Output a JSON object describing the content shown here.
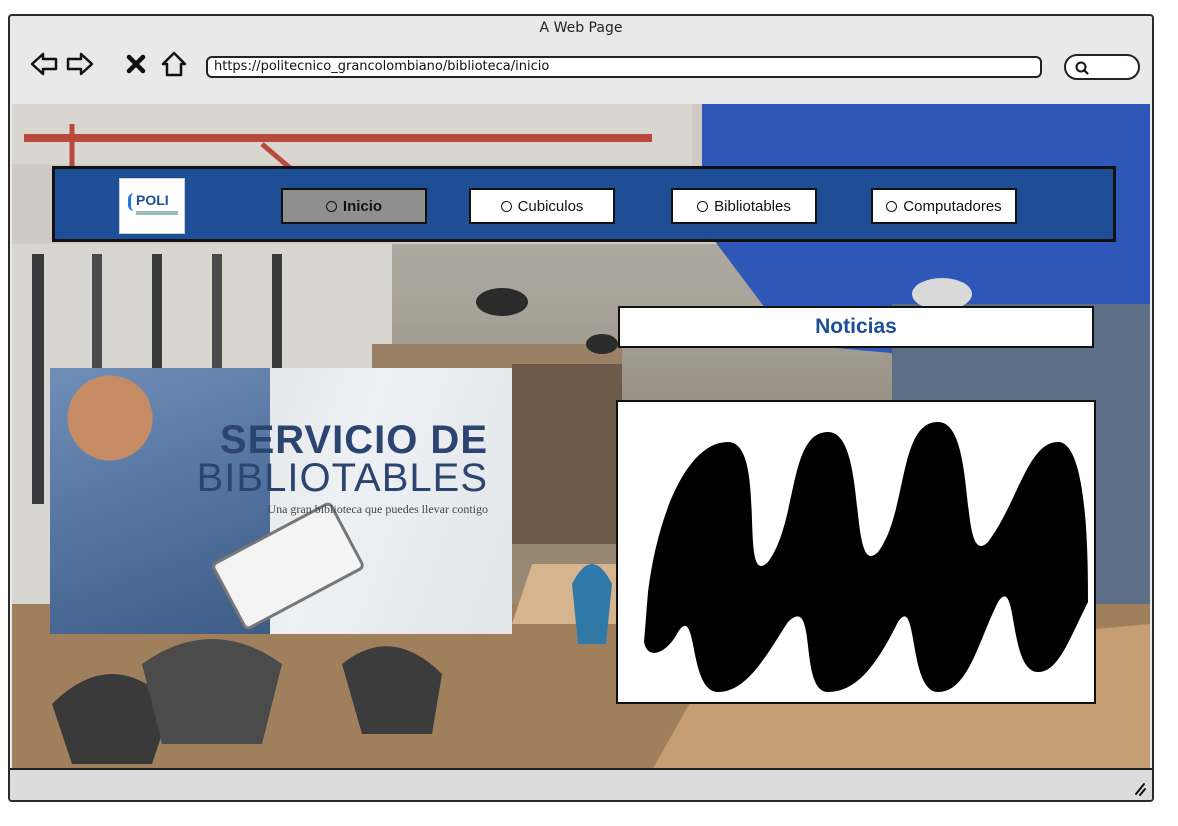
{
  "window": {
    "title": "A Web Page"
  },
  "browser": {
    "url": "https://politecnico_grancolombiano/biblioteca/inicio",
    "buttons": [
      "back",
      "forward",
      "close",
      "home"
    ]
  },
  "logo": {
    "text": "POLI"
  },
  "nav": {
    "items": [
      {
        "label": "Inicio",
        "active": true
      },
      {
        "label": "Cubiculos",
        "active": false
      },
      {
        "label": "Bibliotables",
        "active": false
      },
      {
        "label": "Computadores",
        "active": false
      }
    ]
  },
  "promo": {
    "line1": "SERVICIO DE",
    "line2": "BIBLIOTABLES",
    "tagline": "Una gran biblioteca que puedes llevar contigo"
  },
  "noticias": {
    "title": "Noticias"
  },
  "colors": {
    "brand_blue": "#1e4f96",
    "active_button": "#8f8f8f"
  }
}
